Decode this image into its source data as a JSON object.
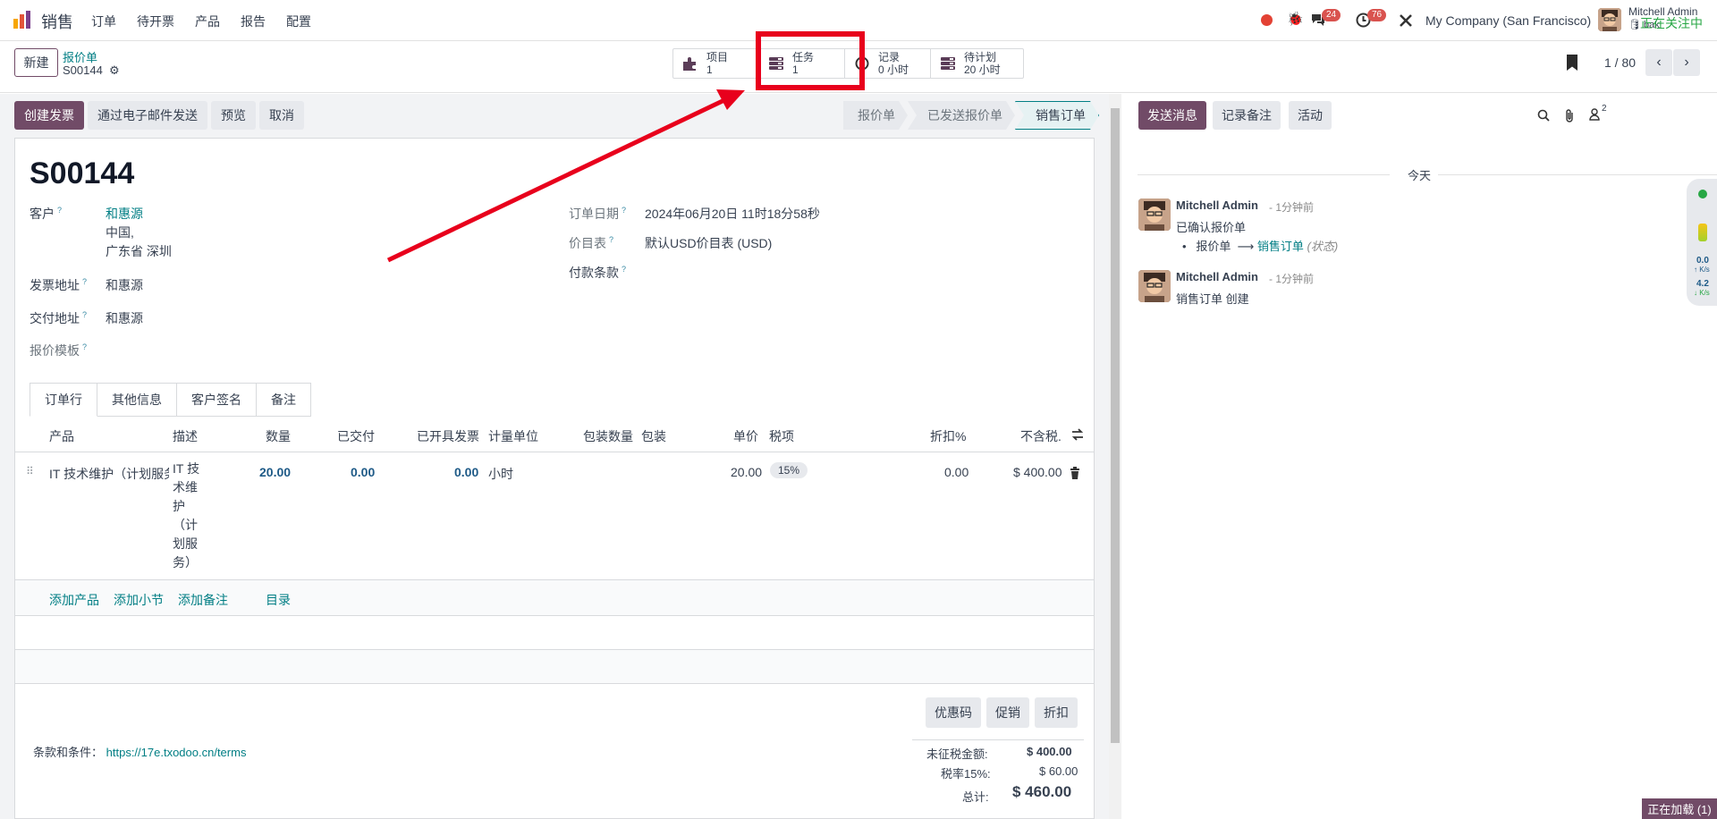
{
  "nav": {
    "app_name": "销售",
    "menu": [
      "订单",
      "待开票",
      "产品",
      "报告",
      "配置"
    ],
    "messages_badge": "24",
    "activities_badge": "76",
    "company": "My Company (San Francisco)",
    "user_name": "Mitchell Admin",
    "user_db": "bak"
  },
  "control": {
    "new_label": "新建",
    "breadcrumb_parent": "报价单",
    "breadcrumb_current": "S00144",
    "stat_buttons": [
      {
        "title": "项目",
        "value": "1",
        "icon": "puzzle-icon"
      },
      {
        "title": "任务",
        "value": "1",
        "icon": "tasks-icon"
      },
      {
        "title": "记录",
        "value": "0 小时",
        "icon": "clock-icon"
      },
      {
        "title": "待计划",
        "value": "20 小时",
        "icon": "tasks-icon"
      }
    ],
    "pager": "1 / 80"
  },
  "actions": {
    "create_invoice": "创建发票",
    "send_email": "通过电子邮件发送",
    "preview": "预览",
    "cancel": "取消"
  },
  "status": [
    "报价单",
    "已发送报价单",
    "销售订单"
  ],
  "form": {
    "name": "S00144",
    "customer_label": "客户",
    "customer_name": "和惠源",
    "customer_addr1": "中国,",
    "customer_addr2": "广东省 深圳",
    "invoice_addr_label": "发票地址",
    "invoice_addr": "和惠源",
    "delivery_addr_label": "交付地址",
    "delivery_addr": "和惠源",
    "template_label": "报价模板",
    "order_date_label": "订单日期",
    "order_date": "2024年06月20日 11时18分58秒",
    "pricelist_label": "价目表",
    "pricelist": "默认USD价目表 (USD)",
    "payment_terms_label": "付款条款"
  },
  "tabs": [
    "订单行",
    "其他信息",
    "客户签名",
    "备注"
  ],
  "table": {
    "headers": {
      "product": "产品",
      "description": "描述",
      "quantity": "数量",
      "delivered": "已交付",
      "invoiced": "已开具发票",
      "uom": "计量单位",
      "pkg_qty": "包装数量",
      "pkg": "包装",
      "price": "单价",
      "taxes": "税项",
      "discount": "折扣%",
      "subtotal": "不含税."
    },
    "row": {
      "product": "IT 技术维护（计划服务",
      "description": [
        "IT 技",
        "术维",
        "护",
        "（计",
        "划服",
        "务）"
      ],
      "quantity": "20.00",
      "delivered": "0.00",
      "invoiced": "0.00",
      "uom": "小时",
      "price": "20.00",
      "tax": "15%",
      "discount": "0.00",
      "subtotal": "$ 400.00"
    },
    "add_links": [
      "添加产品",
      "添加小节",
      "添加备注",
      "目录"
    ]
  },
  "summary": {
    "buttons": [
      "优惠码",
      "促销",
      "折扣"
    ],
    "terms_label": "条款和条件：",
    "terms_link": "https://17e.txodoo.cn/terms",
    "untaxed_label": "未征税金额:",
    "untaxed": "$ 400.00",
    "tax_label": "税率15%:",
    "tax": "$ 60.00",
    "total_label": "总计:",
    "total": "$ 460.00"
  },
  "chatter": {
    "send_message": "发送消息",
    "log_note": "记录备注",
    "activity": "活动",
    "followers_count": "2",
    "following": "正在关注中",
    "date_divider": "今天",
    "messages": [
      {
        "author": "Mitchell Admin",
        "time": "- 1分钟前",
        "body": "已确认报价单",
        "change_from": "报价单",
        "change_to": "销售订单",
        "change_field": "(状态)"
      },
      {
        "author": "Mitchell Admin",
        "time": "- 1分钟前",
        "body": "销售订单 创建"
      }
    ]
  },
  "widget": {
    "up": "0.0",
    "down": "4.2",
    "unit": "K/s"
  },
  "loading": "正在加载 (1)"
}
